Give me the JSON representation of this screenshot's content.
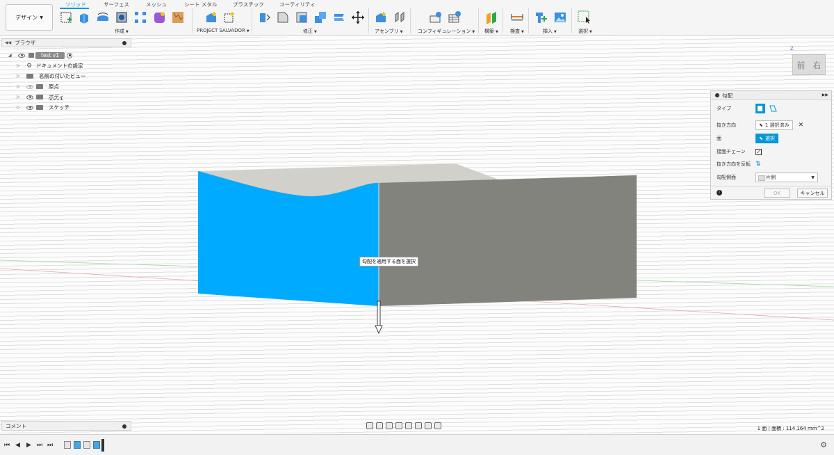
{
  "workspace": {
    "label": "デザイン"
  },
  "tabs": [
    {
      "label": "ソリッド",
      "active": true
    },
    {
      "label": "サーフェス",
      "active": false
    },
    {
      "label": "メッシュ",
      "active": false
    },
    {
      "label": "シート メタル",
      "active": false
    },
    {
      "label": "プラスチック",
      "active": false
    },
    {
      "label": "ユーティリティ",
      "active": false
    }
  ],
  "groups": {
    "create": "作成",
    "project": "PROJECT SALVADOR",
    "modify": "修正",
    "assemble": "アセンブリ",
    "configure": "コンフィギュレーション",
    "construct": "構築",
    "inspect": "検査",
    "insert": "挿入",
    "select": "選択"
  },
  "browser": {
    "title": "ブラウザ",
    "root": "test v1",
    "items": [
      {
        "label": "ドキュメントの設定",
        "icon": "gear-icon"
      },
      {
        "label": "名前の付いたビュー",
        "icon": "folder-icon"
      },
      {
        "label": "原点",
        "icon": "folder-icon",
        "eye": "off"
      },
      {
        "label": "ボディ",
        "icon": "folder-icon",
        "eye": "on"
      },
      {
        "label": "スケッチ",
        "icon": "folder-icon",
        "eye": "on"
      }
    ]
  },
  "viewcube": {
    "front": "前",
    "right": "右",
    "axis": "Z"
  },
  "dialog": {
    "title": "勾配",
    "rows": {
      "type": "タイプ",
      "pull_direction": "抜き方向",
      "pull_value": "1 選択済み",
      "faces": "面",
      "faces_value": "選択",
      "tangent_chain": "接面チェーン",
      "flip_direction": "抜き方向を反転",
      "draft_sides": "勾配側面",
      "draft_sides_value": "片側"
    },
    "ok": "OK",
    "cancel": "キャンセル"
  },
  "tooltip": "勾配を適用する面を選択",
  "comments": {
    "label": "コメント"
  },
  "status": "1 面 | 面積 : 114.164 mm^2",
  "colors": {
    "accent": "#0696d7",
    "selected_face": "#00aaff",
    "body": "#83837d"
  }
}
